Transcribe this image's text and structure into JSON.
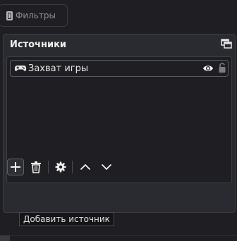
{
  "filters_tab": {
    "label": "Фильтры",
    "icon": "filter-icon"
  },
  "sources_dock": {
    "title": "Источники",
    "undock_icon": "undock-icon",
    "items": [
      {
        "label": "Захват игры",
        "icon": "gamepad-icon",
        "visible": true,
        "locked": false
      }
    ]
  },
  "toolbar": {
    "buttons": [
      {
        "name": "add",
        "icon": "plus-icon"
      },
      {
        "name": "remove",
        "icon": "trash-icon"
      },
      {
        "name": "properties",
        "icon": "gear-icon"
      },
      {
        "name": "move-up",
        "icon": "chevron-up-icon"
      },
      {
        "name": "move-down",
        "icon": "chevron-down-icon"
      }
    ]
  },
  "tooltip": {
    "text": "Добавить источник"
  },
  "colors": {
    "background": "#1f1f23",
    "panel": "#2a2b30",
    "border": "#3d3e44",
    "text": "#e6e6e6"
  }
}
